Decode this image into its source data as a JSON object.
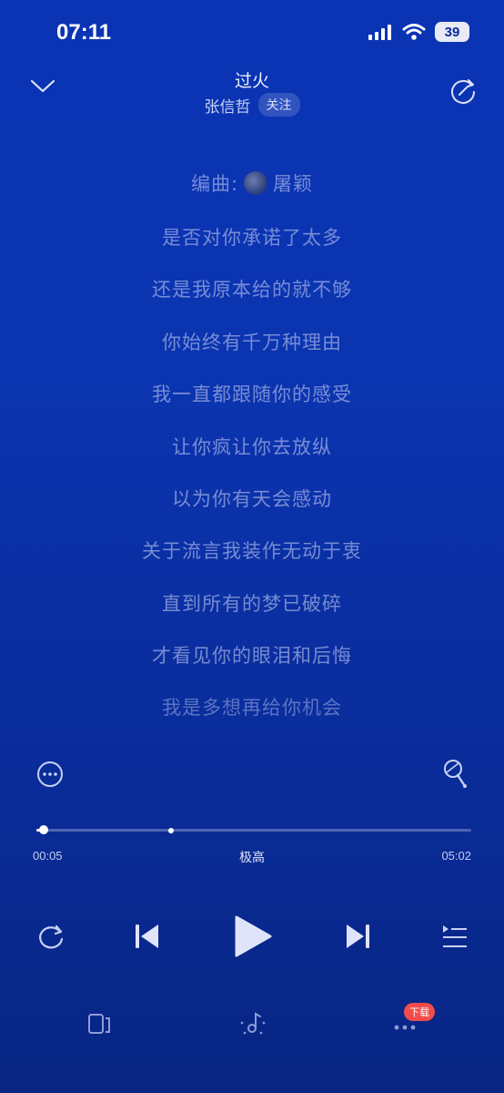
{
  "status": {
    "time": "07:11",
    "battery": "39"
  },
  "header": {
    "title": "过火",
    "artist": "张信哲",
    "follow_label": "关注"
  },
  "lyrics": {
    "credit_label": "编曲:",
    "credit_name": "屠颖",
    "lines": [
      "是否对你承诺了太多",
      "还是我原本给的就不够",
      "你始终有千万种理由",
      "我一直都跟随你的感受",
      "让你疯让你去放纵",
      "以为你有天会感动",
      "关于流言我装作无动于衷",
      "直到所有的梦已破碎",
      "才看见你的眼泪和后悔",
      "我是多想再给你机会"
    ]
  },
  "player": {
    "current_time": "00:05",
    "total_time": "05:02",
    "quality": "极高",
    "progress": 0.017,
    "buffered": 0.31
  },
  "bottom": {
    "download_badge": "下载"
  },
  "colors": {
    "background_top": "#0a34b4",
    "background_bottom": "#082582",
    "badge": "#f24b4b"
  },
  "icons": [
    "chevron-down-icon",
    "share-icon",
    "more-icon",
    "microphone-icon",
    "repeat-icon",
    "previous-icon",
    "play-icon",
    "next-icon",
    "playlist-icon",
    "device-icon",
    "music-effect-icon",
    "more-dots-icon"
  ]
}
